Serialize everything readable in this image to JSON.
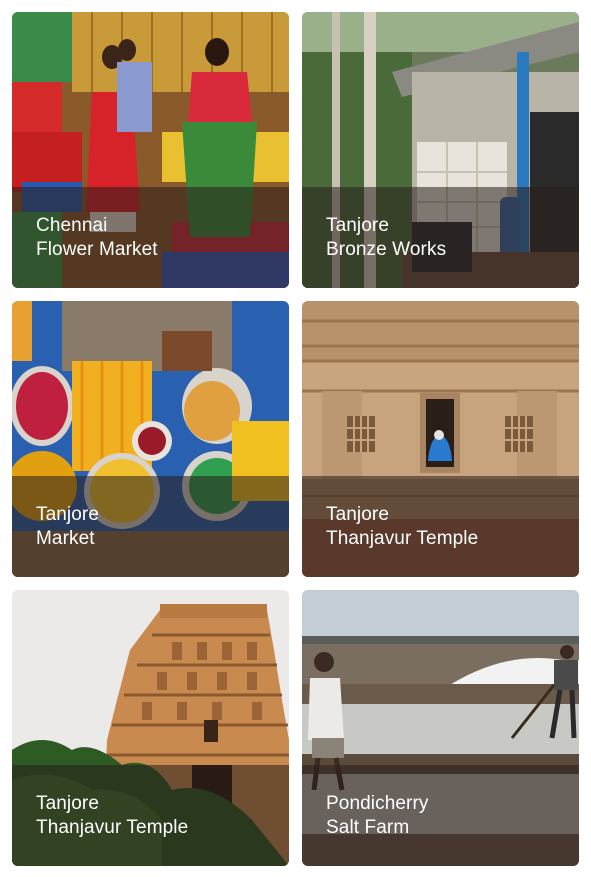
{
  "cards": [
    {
      "line1": "Chennai",
      "line2": "Flower Market"
    },
    {
      "line1": "Tanjore",
      "line2": "Bronze Works"
    },
    {
      "line1": "Tanjore",
      "line2": "Market"
    },
    {
      "line1": "Tanjore",
      "line2": "Thanjavur Temple"
    },
    {
      "line1": "Tanjore",
      "line2": "Thanjavur Temple"
    },
    {
      "line1": "Pondicherry",
      "line2": "Salt Farm"
    }
  ]
}
